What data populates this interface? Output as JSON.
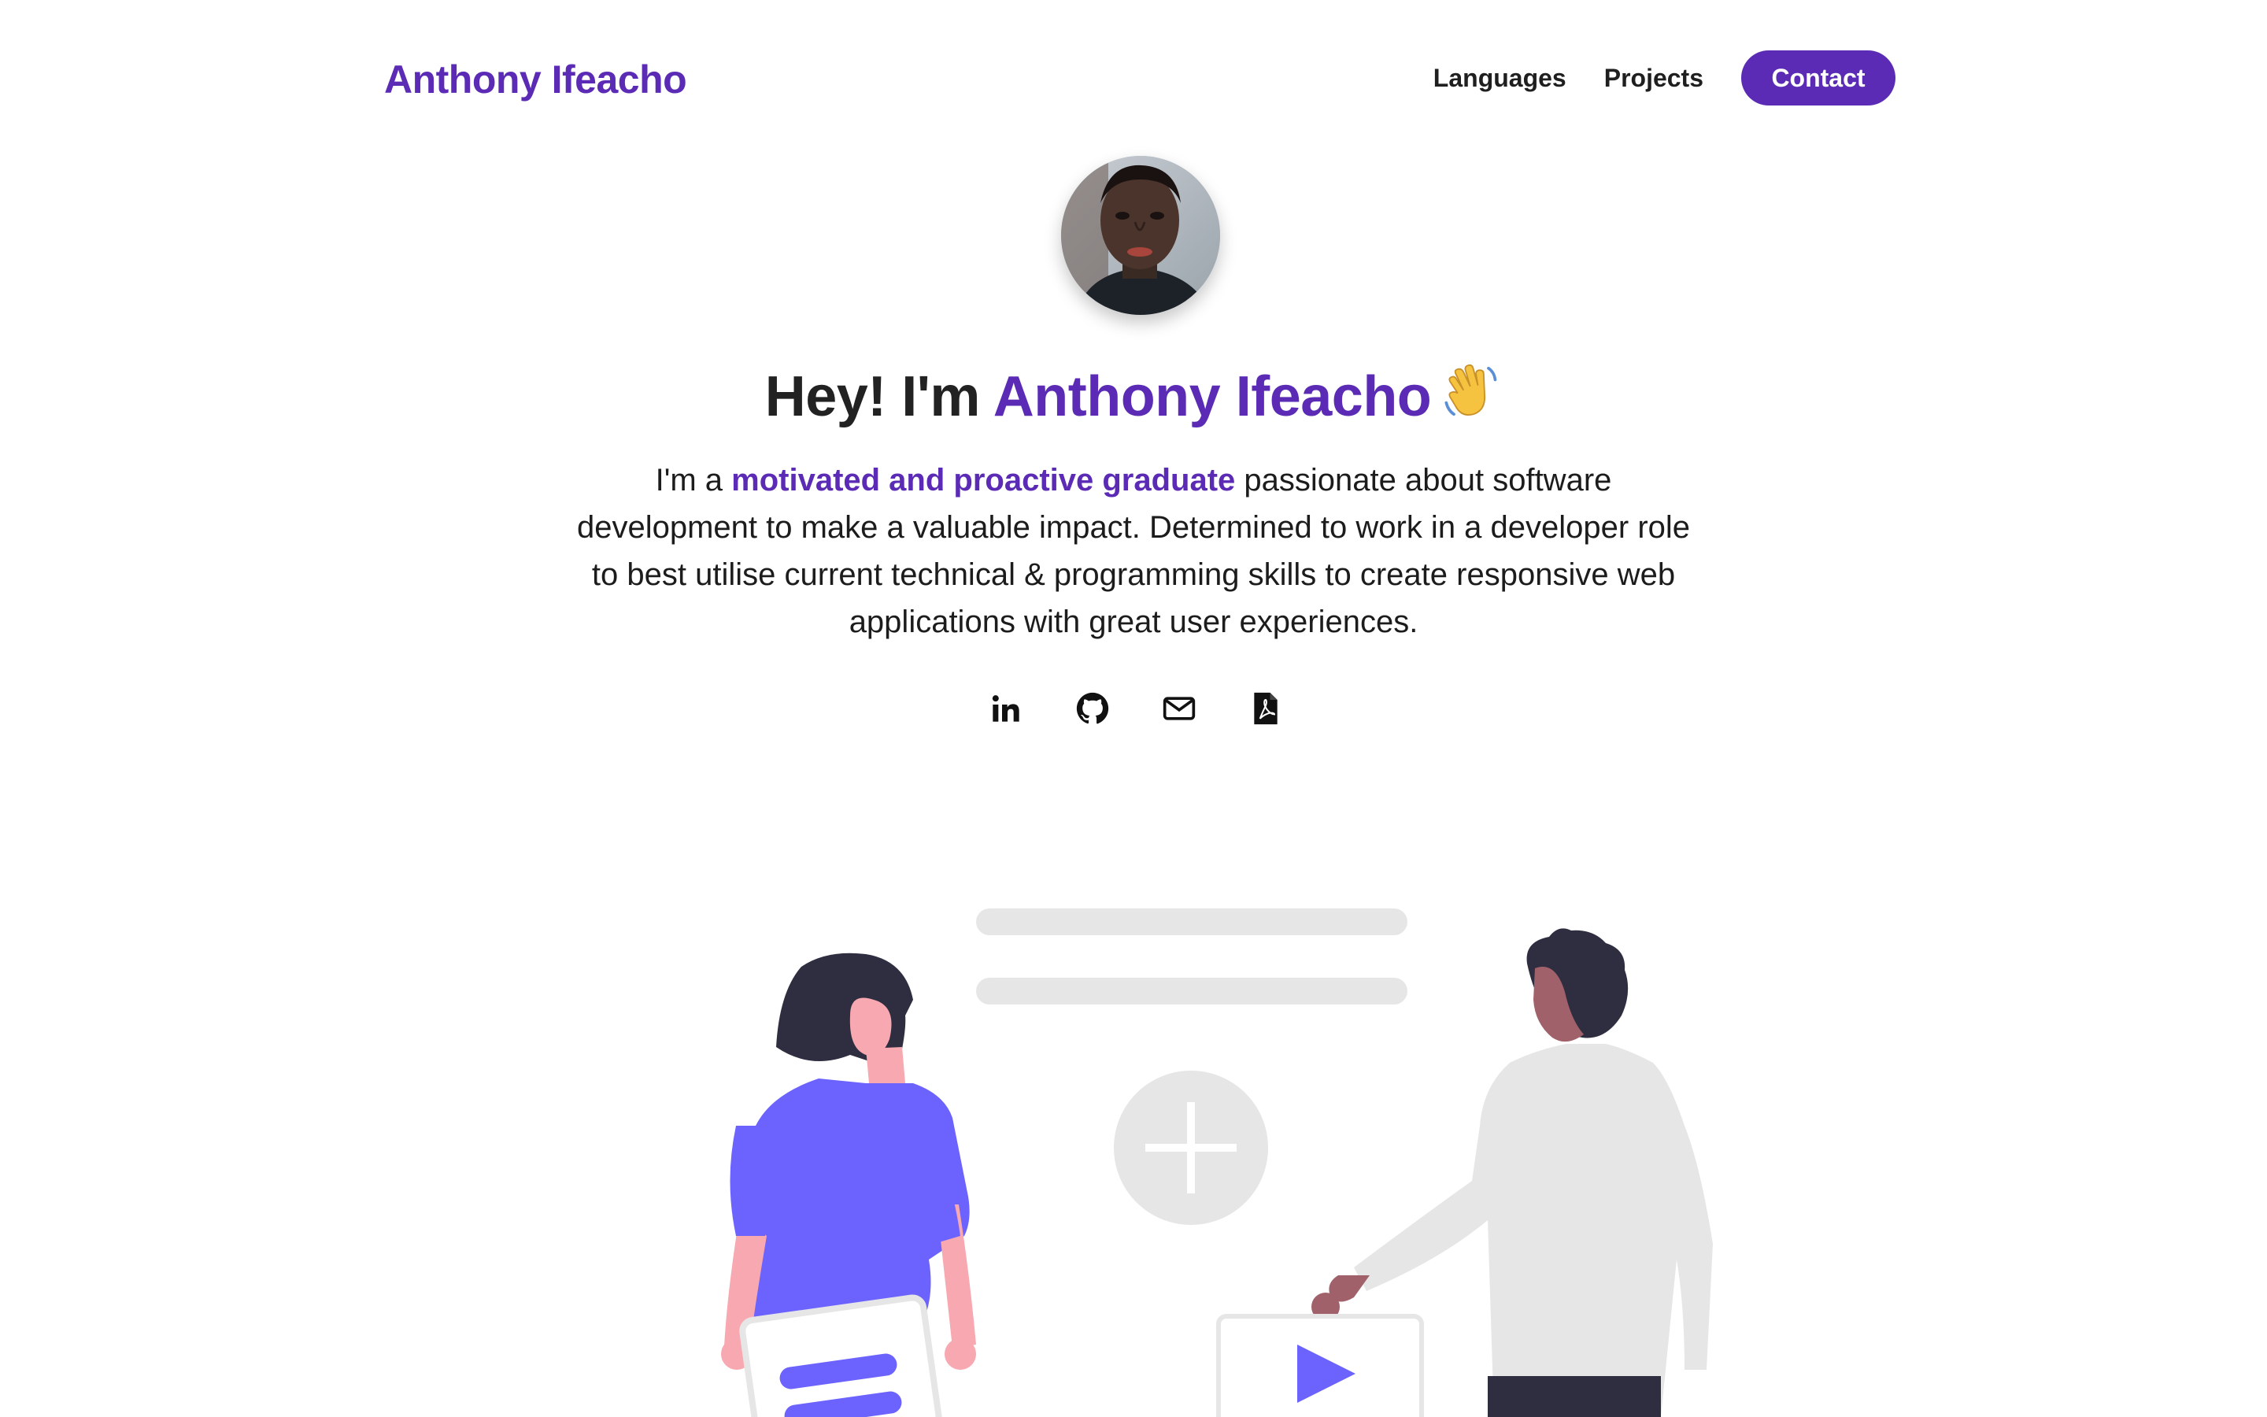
{
  "header": {
    "brand": "Anthony Ifeacho",
    "nav": {
      "languages": "Languages",
      "projects": "Projects",
      "contact": "Contact"
    }
  },
  "hero": {
    "greeting": "Hey! I'm ",
    "name": "Anthony Ifeacho",
    "intro_before": "I'm a ",
    "intro_highlight": "motivated and proactive graduate",
    "intro_after": " passionate about software development to make a valuable impact. Determined to work in a developer role to best utilise current technical & programming skills to create responsive web applications with great user experiences."
  },
  "social_icons": [
    "linkedin-icon",
    "github-icon",
    "mail-icon",
    "pdf-icon"
  ],
  "colors": {
    "accent": "#5b2bb5",
    "illustration_accent": "#6c63ff",
    "text": "#1f1f1f",
    "placeholder_gray": "#e6e6e6"
  }
}
